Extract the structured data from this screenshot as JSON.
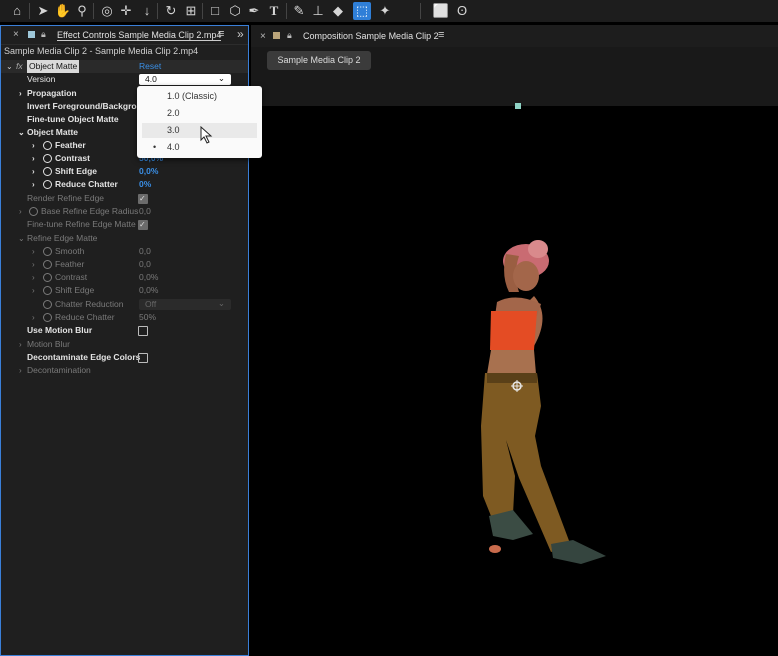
{
  "toolbar": {
    "icons": [
      "home-icon",
      "selection-arrow-icon",
      "hand-icon",
      "zoom-icon",
      "orbit-camera-icon",
      "move-icon",
      "pan-down-icon",
      "rotate-icon",
      "anchor-point-icon",
      "rectangle-icon",
      "cube-icon",
      "pen-icon",
      "type-icon",
      "brush-icon",
      "clone-stamp-icon",
      "eraser-icon",
      "roto-brush-icon",
      "puppet-pin-icon",
      "marquee-icon",
      "lasso-icon"
    ]
  },
  "effect_panel": {
    "close": "×",
    "tab_title": "Effect Controls",
    "tab_clip": "Sample Media Clip 2.mp4",
    "menu": "≡",
    "expand": "»",
    "clip_line": "Sample Media Clip 2 - Sample Media Clip 2.mp4",
    "fx": "fx",
    "effect_name": "Object Matte",
    "reset": "Reset",
    "version_label": "Version",
    "version_value": "4.0",
    "rows": {
      "propagation": "Propagation",
      "invert": "Invert Foreground/Backgrou",
      "fine_tune": "Fine-tune Object Matte",
      "object_matte": "Object Matte",
      "feather": "Feather",
      "contrast": "Contrast",
      "contrast_value": "50,0%",
      "shift_edge": "Shift Edge",
      "shift_edge_value": "0,0%",
      "reduce_chatter": "Reduce Chatter",
      "reduce_chatter_value": "0%",
      "render_refine": "Render Refine Edge",
      "base_refine": "Base Refine Edge Radius",
      "base_refine_value": "0,0",
      "fine_tune_refine": "Fine-tune Refine Edge Matte",
      "refine_edge_matte": "Refine Edge Matte",
      "smooth": "Smooth",
      "smooth_value": "0,0",
      "feather2": "Feather",
      "feather2_value": "0,0",
      "contrast2": "Contrast",
      "contrast2_value": "0,0%",
      "shift_edge2": "Shift Edge",
      "shift_edge2_value": "0,0%",
      "chatter_reduction": "Chatter Reduction",
      "chatter_reduction_value": "Off",
      "reduce_chatter2": "Reduce Chatter",
      "reduce_chatter2_value": "50%",
      "use_motion_blur": "Use Motion Blur",
      "motion_blur": "Motion Blur",
      "decontaminate": "Decontaminate Edge Colors",
      "decontamination": "Decontamination"
    }
  },
  "version_menu": {
    "items": [
      "1.0 (Classic)",
      "2.0",
      "3.0",
      "4.0"
    ],
    "selected": "4.0",
    "hovered": "3.0",
    "bullet": "•"
  },
  "composition": {
    "close": "×",
    "title": "Composition",
    "name": "Sample Media Clip 2",
    "menu": "≡",
    "clip_button": "Sample Media Clip 2"
  },
  "colors": {
    "accent_blue": "#3a8fe6",
    "panel_bg": "#1f1f1f",
    "viewer_bg": "#000000"
  }
}
